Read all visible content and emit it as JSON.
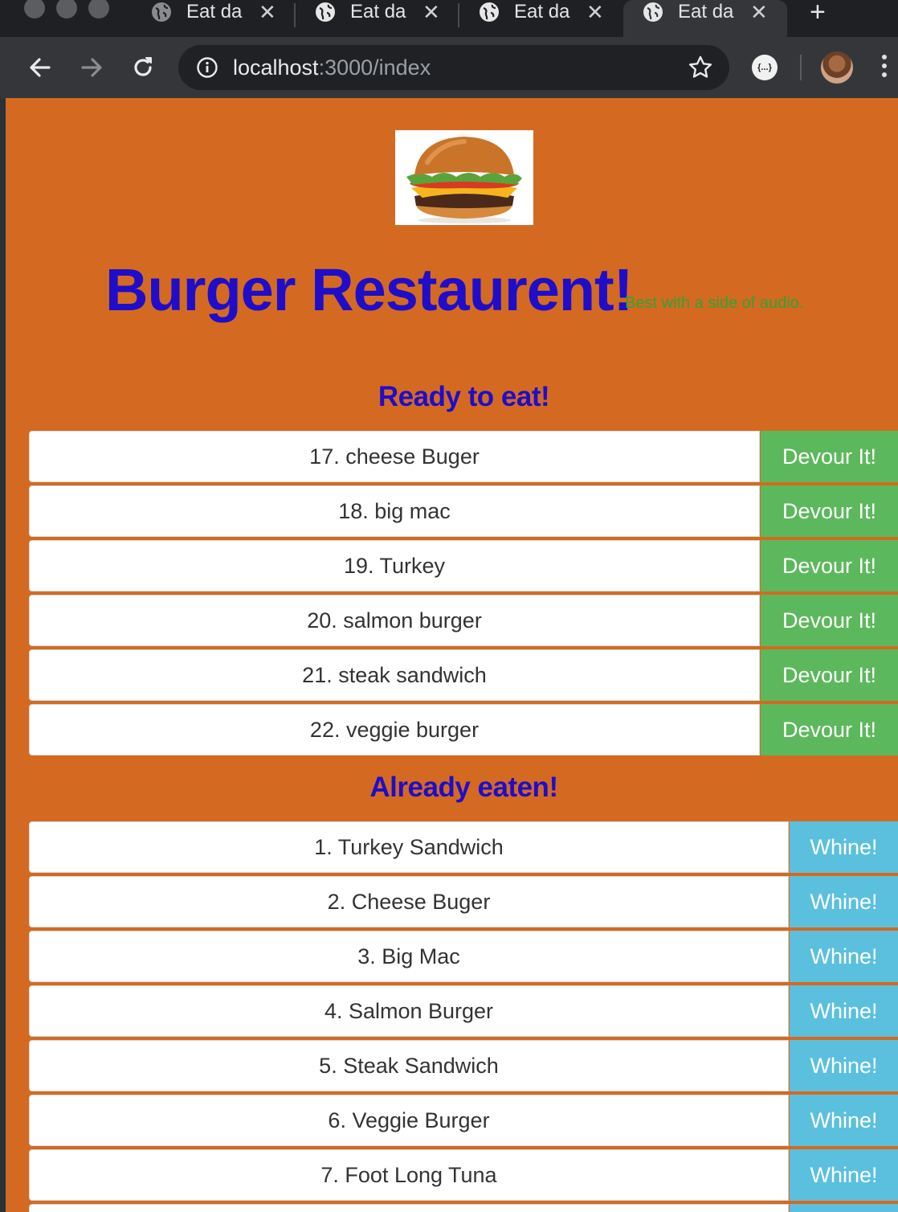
{
  "browser": {
    "tabs": [
      {
        "title": "Eat da",
        "active": false
      },
      {
        "title": "Eat da",
        "active": false
      },
      {
        "title": "Eat da",
        "active": false
      },
      {
        "title": "Eat da",
        "active": true
      }
    ],
    "url_host": "localhost",
    "url_path": ":3000/index",
    "extension_label": "{...}"
  },
  "page": {
    "title": "Burger Restaurent!",
    "subtitle": "Best with a side of audio.",
    "ready_heading": "Ready to eat!",
    "eaten_heading": "Already eaten!",
    "ready": [
      {
        "label": "17. cheese Buger",
        "action": "Devour It!"
      },
      {
        "label": "18. big mac",
        "action": "Devour It!"
      },
      {
        "label": "19. Turkey",
        "action": "Devour It!"
      },
      {
        "label": "20. salmon burger",
        "action": "Devour It!"
      },
      {
        "label": "21. steak sandwich",
        "action": "Devour It!"
      },
      {
        "label": "22. veggie burger",
        "action": "Devour It!"
      }
    ],
    "eaten": [
      {
        "label": "1. Turkey Sandwich",
        "action": "Whine!"
      },
      {
        "label": "2. Cheese Buger",
        "action": "Whine!"
      },
      {
        "label": "3. Big Mac",
        "action": "Whine!"
      },
      {
        "label": "4. Salmon Burger",
        "action": "Whine!"
      },
      {
        "label": "5. Steak Sandwich",
        "action": "Whine!"
      },
      {
        "label": "6. Veggie Burger",
        "action": "Whine!"
      },
      {
        "label": "7. Foot Long Tuna",
        "action": "Whine!"
      }
    ]
  },
  "colors": {
    "page_bg": "#d46a21",
    "heading": "#1f0dca",
    "subtitle": "#2ea532",
    "devour": "#5cb85c",
    "whine": "#5bc0de"
  }
}
